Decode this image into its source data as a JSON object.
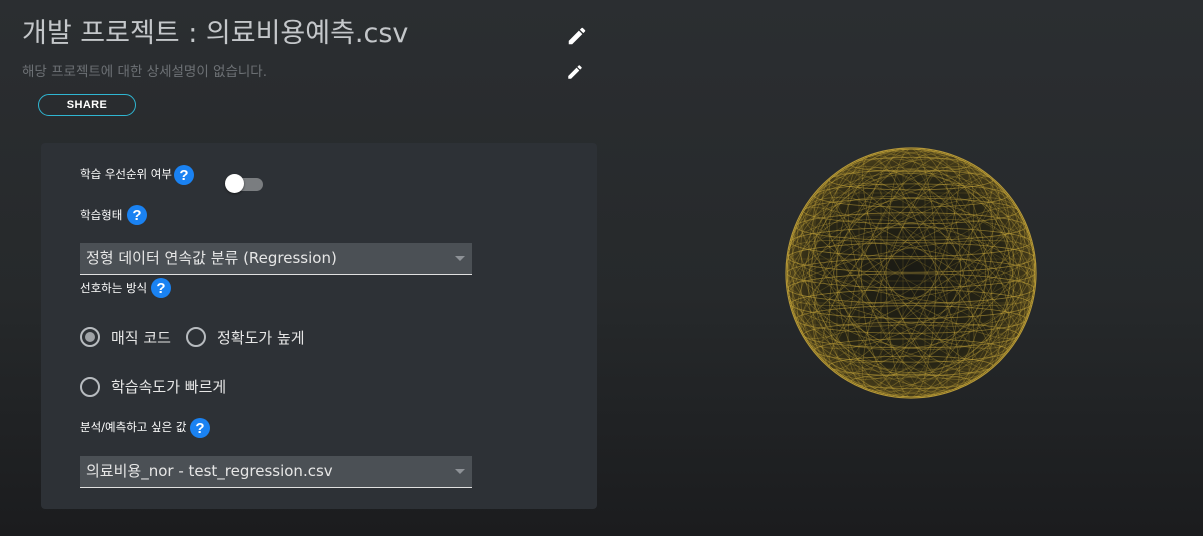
{
  "header": {
    "title": "개발 프로젝트 : 의료비용예측.csv",
    "description": "해당 프로젝트에 대한 상세설명이 없습니다.",
    "share_label": "SHARE",
    "title_edit_icon": "pencil-icon",
    "description_edit_icon": "pencil-icon"
  },
  "form": {
    "priority": {
      "label": "학습 우선순위 여부",
      "help": "?",
      "enabled": false
    },
    "learning_type": {
      "label": "학습형태",
      "help": "?",
      "selected": "정형 데이터 연속값 분류 (Regression)"
    },
    "preference": {
      "label": "선호하는 방식",
      "help": "?",
      "options": [
        "매직 코드",
        "정확도가 높게",
        "학습속도가 빠르게"
      ],
      "selected": "매직 코드"
    },
    "target": {
      "label": "분석/예측하고 싶은 값",
      "help": "?",
      "selected": "의료비용_nor - test_regression.csv"
    }
  },
  "colors": {
    "accent": "#2fb6d2",
    "help_icon": "#1a82f2",
    "sphere_wire": "#c9a83c"
  }
}
